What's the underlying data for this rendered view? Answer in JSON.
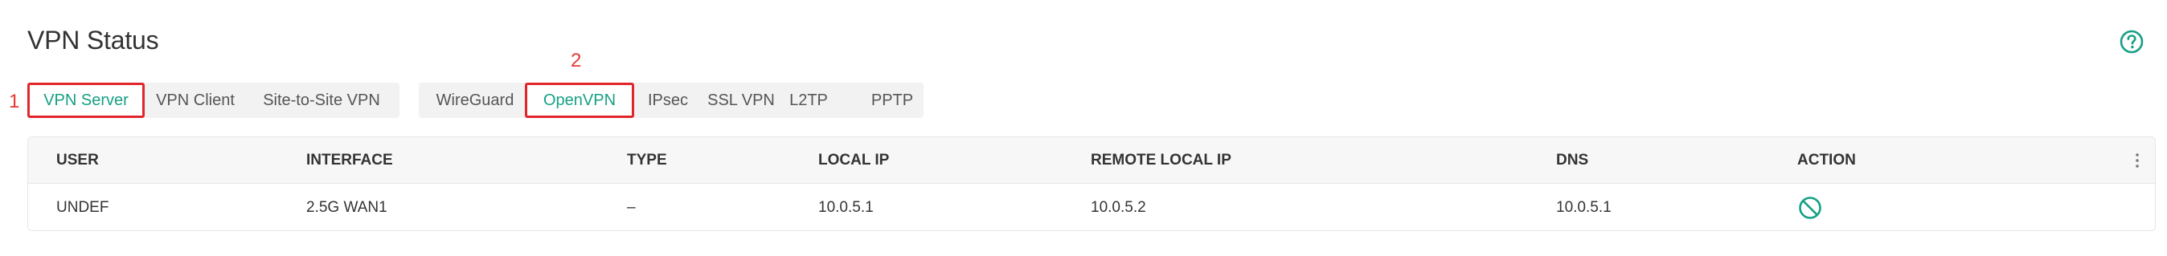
{
  "page": {
    "title": "VPN Status"
  },
  "annotations": {
    "first": "1",
    "second": "2"
  },
  "tabs_primary": [
    {
      "label": "VPN Server",
      "active": true
    },
    {
      "label": "VPN Client",
      "active": false
    },
    {
      "label": "Site-to-Site VPN",
      "active": false
    }
  ],
  "tabs_secondary": [
    {
      "label": "WireGuard",
      "active": false
    },
    {
      "label": "OpenVPN",
      "active": true
    },
    {
      "label": "IPsec",
      "active": false
    },
    {
      "label": "SSL VPN",
      "active": false
    },
    {
      "label": "L2TP",
      "active": false
    },
    {
      "label": "PPTP",
      "active": false
    }
  ],
  "table": {
    "columns": [
      "USER",
      "INTERFACE",
      "TYPE",
      "LOCAL IP",
      "REMOTE LOCAL IP",
      "DNS",
      "ACTION"
    ],
    "rows": [
      {
        "user": "UNDEF",
        "interface": "2.5G WAN1",
        "type": "–",
        "local_ip": "10.0.5.1",
        "remote_local_ip": "10.0.5.2",
        "dns": "10.0.5.1",
        "action_icon": "disconnect-icon"
      }
    ]
  },
  "colors": {
    "accent": "#16a085",
    "annotation": "#e0252b"
  }
}
